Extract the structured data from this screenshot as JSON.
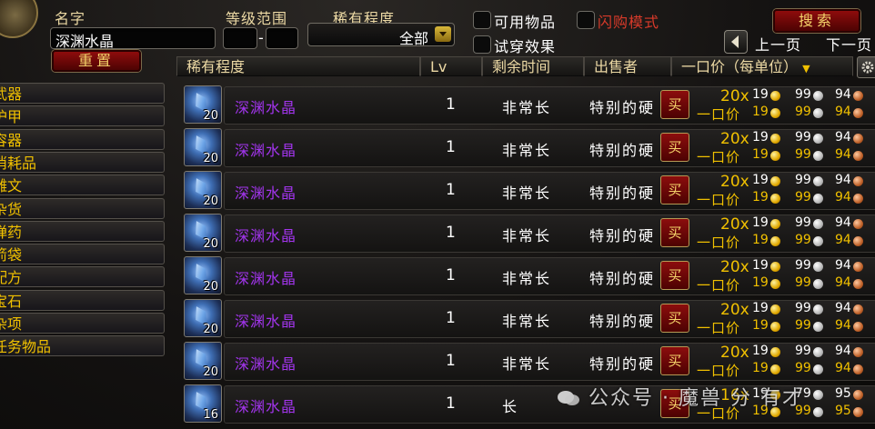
{
  "filters": {
    "name_label": "名字",
    "name_value": "深渊水晶",
    "level_label": "等级范围",
    "level_sep": "-",
    "rarity_label": "稀有程度",
    "rarity_value": "全部",
    "usable_label": "可用物品",
    "flash_label": "闪购模式",
    "tryon_label": "试穿效果",
    "reset_label": "重置",
    "search_label": "搜索",
    "prev_label": "上一页",
    "next_label": "下一页"
  },
  "columns": [
    "稀有程度",
    "Lv",
    "剩余时间",
    "出售者",
    "一口价（每单位）"
  ],
  "categories": [
    "武器",
    "护甲",
    "容器",
    "消耗品",
    "雕文",
    "杂货",
    "弹药",
    "箭袋",
    "配方",
    "宝石",
    "杂项",
    "任务物品"
  ],
  "buy_label": "买",
  "buyout_label": "一口价",
  "rows": [
    {
      "count": "20",
      "name": "深渊水晶",
      "lv": "1",
      "time": "非常长",
      "seller": "特别的硬",
      "qty": "20x",
      "bid": [
        "19",
        "99",
        "94"
      ],
      "buyout": [
        "19",
        "99",
        "94"
      ]
    },
    {
      "count": "20",
      "name": "深渊水晶",
      "lv": "1",
      "time": "非常长",
      "seller": "特别的硬",
      "qty": "20x",
      "bid": [
        "19",
        "99",
        "94"
      ],
      "buyout": [
        "19",
        "99",
        "94"
      ]
    },
    {
      "count": "20",
      "name": "深渊水晶",
      "lv": "1",
      "time": "非常长",
      "seller": "特别的硬",
      "qty": "20x",
      "bid": [
        "19",
        "99",
        "94"
      ],
      "buyout": [
        "19",
        "99",
        "94"
      ]
    },
    {
      "count": "20",
      "name": "深渊水晶",
      "lv": "1",
      "time": "非常长",
      "seller": "特别的硬",
      "qty": "20x",
      "bid": [
        "19",
        "99",
        "94"
      ],
      "buyout": [
        "19",
        "99",
        "94"
      ]
    },
    {
      "count": "20",
      "name": "深渊水晶",
      "lv": "1",
      "time": "非常长",
      "seller": "特别的硬",
      "qty": "20x",
      "bid": [
        "19",
        "99",
        "94"
      ],
      "buyout": [
        "19",
        "99",
        "94"
      ]
    },
    {
      "count": "20",
      "name": "深渊水晶",
      "lv": "1",
      "time": "非常长",
      "seller": "特别的硬",
      "qty": "20x",
      "bid": [
        "19",
        "99",
        "94"
      ],
      "buyout": [
        "19",
        "99",
        "94"
      ]
    },
    {
      "count": "20",
      "name": "深渊水晶",
      "lv": "1",
      "time": "非常长",
      "seller": "特别的硬",
      "qty": "20x",
      "bid": [
        "19",
        "99",
        "94"
      ],
      "buyout": [
        "19",
        "99",
        "94"
      ]
    },
    {
      "count": "16",
      "name": "深渊水晶",
      "lv": "1",
      "time": "长",
      "seller": "",
      "qty": "16x",
      "bid": [
        "19",
        "79",
        "95"
      ],
      "buyout": [
        "19",
        "99",
        "95"
      ]
    }
  ],
  "watermark": "公众号 · 魔兽 分 有才",
  "colors": {
    "gold": "#f0c000",
    "epic": "#a335ee",
    "label": "#ecd9a4"
  },
  "icons": {
    "item": "abyss-crystal-icon",
    "dropdown": "dropdown-arrow-icon",
    "prev": "prev-page-arrow-icon",
    "options": "gear-icon"
  }
}
